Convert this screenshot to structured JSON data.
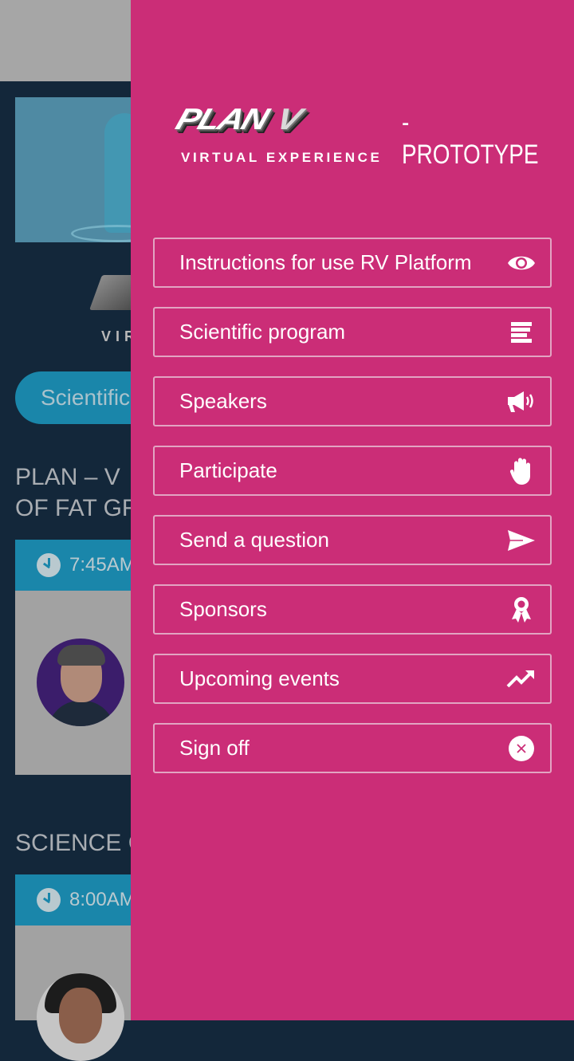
{
  "background": {
    "brand_sub_partial": "VIR",
    "tab_pill_label": "Scientific",
    "sections": [
      {
        "title_line1": "PLAN – V",
        "title_line2": "OF FAT GR",
        "session_time": "7:45AM"
      },
      {
        "title_line1": "SCIENCE C",
        "session_time": "8:00AM"
      }
    ]
  },
  "drawer": {
    "brand": {
      "logo_text": "PLAN",
      "logo_v": "V",
      "suffix": "- PROTOTYPE",
      "subtitle": "VIRTUAL EXPERIENCE"
    },
    "colors": {
      "drawer_bg": "#cb2d77",
      "item_border": "#e2a4c2",
      "text": "#ffffff"
    },
    "menu": [
      {
        "label": "Instructions for use RV Platform",
        "icon": "eye-icon"
      },
      {
        "label": "Scientific program",
        "icon": "list-lines-icon"
      },
      {
        "label": "Speakers",
        "icon": "megaphone-icon"
      },
      {
        "label": "Participate",
        "icon": "raised-hand-icon"
      },
      {
        "label": "Send a question",
        "icon": "send-icon"
      },
      {
        "label": "Sponsors",
        "icon": "award-ribbon-icon"
      },
      {
        "label": "Upcoming events",
        "icon": "trending-up-icon"
      },
      {
        "label": "Sign off",
        "icon": "close-circle-icon"
      }
    ]
  }
}
